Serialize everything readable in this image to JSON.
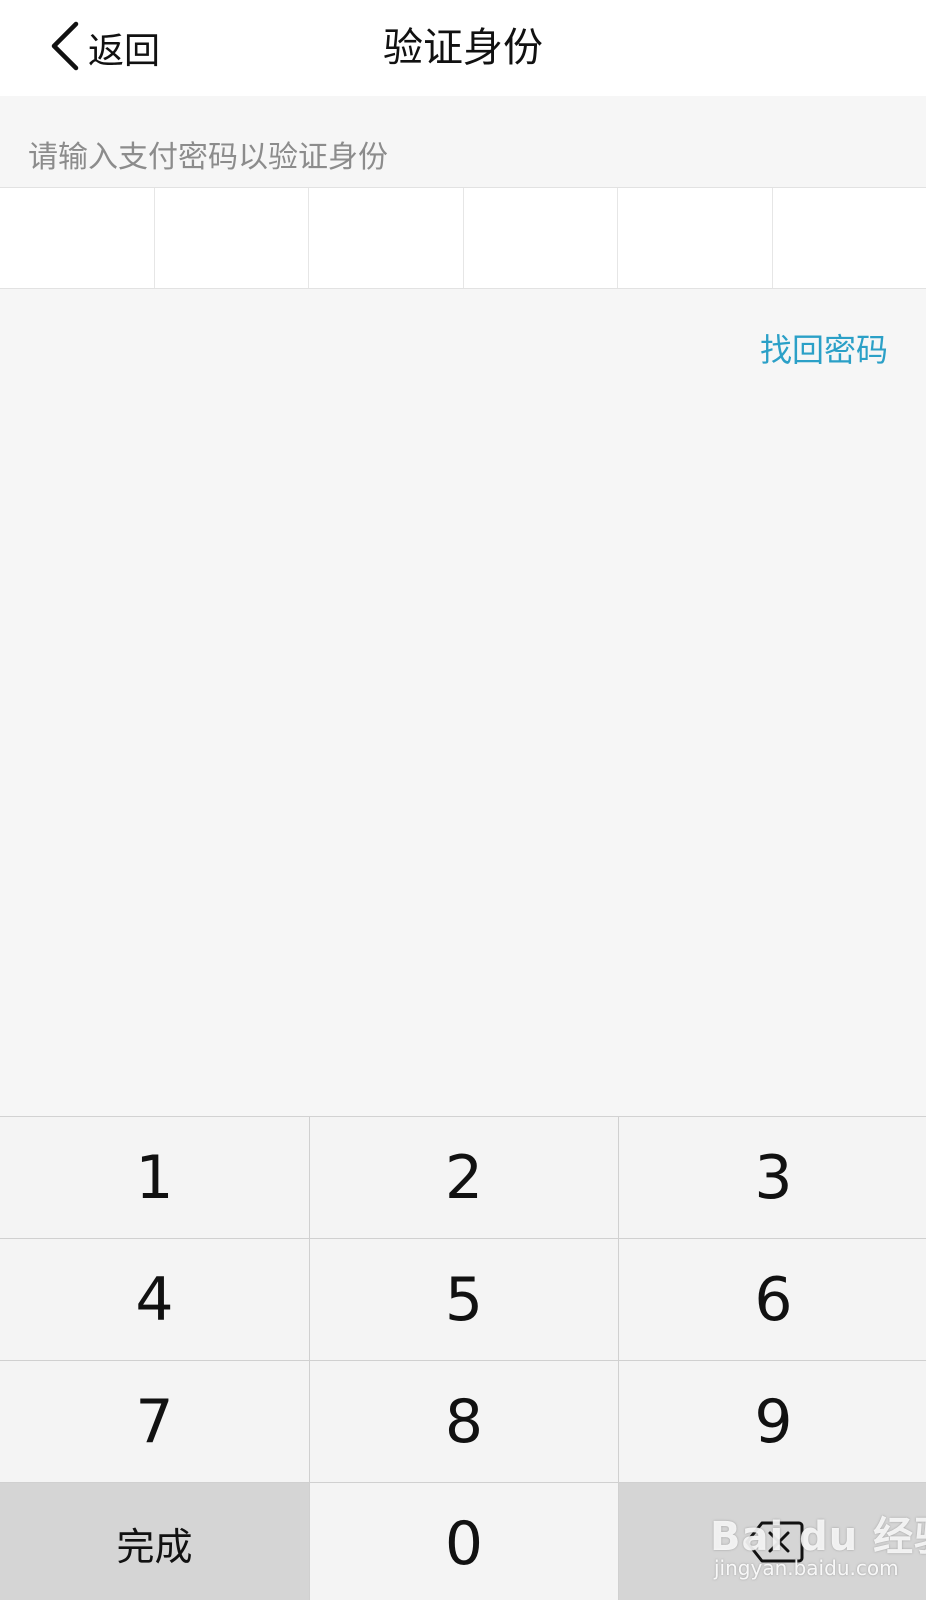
{
  "navbar": {
    "back_label": "返回",
    "title": "验证身份"
  },
  "prompt": "请输入支付密码以验证身份",
  "pin": {
    "digit_count": 6,
    "entered": 0
  },
  "forgot_link": "找回密码",
  "keypad": {
    "keys": [
      "1",
      "2",
      "3",
      "4",
      "5",
      "6",
      "7",
      "8",
      "9"
    ],
    "done_label": "完成",
    "zero_label": "0",
    "delete_icon": "backspace-icon"
  },
  "watermark": {
    "main": "Bai du 经验",
    "sub": "jingyan.baidu.com"
  },
  "colors": {
    "link": "#2ba0c7",
    "prompt_text": "#8c8c8c",
    "background": "#f6f6f6",
    "key": "#f4f4f4",
    "function_key": "#d5d5d5"
  }
}
